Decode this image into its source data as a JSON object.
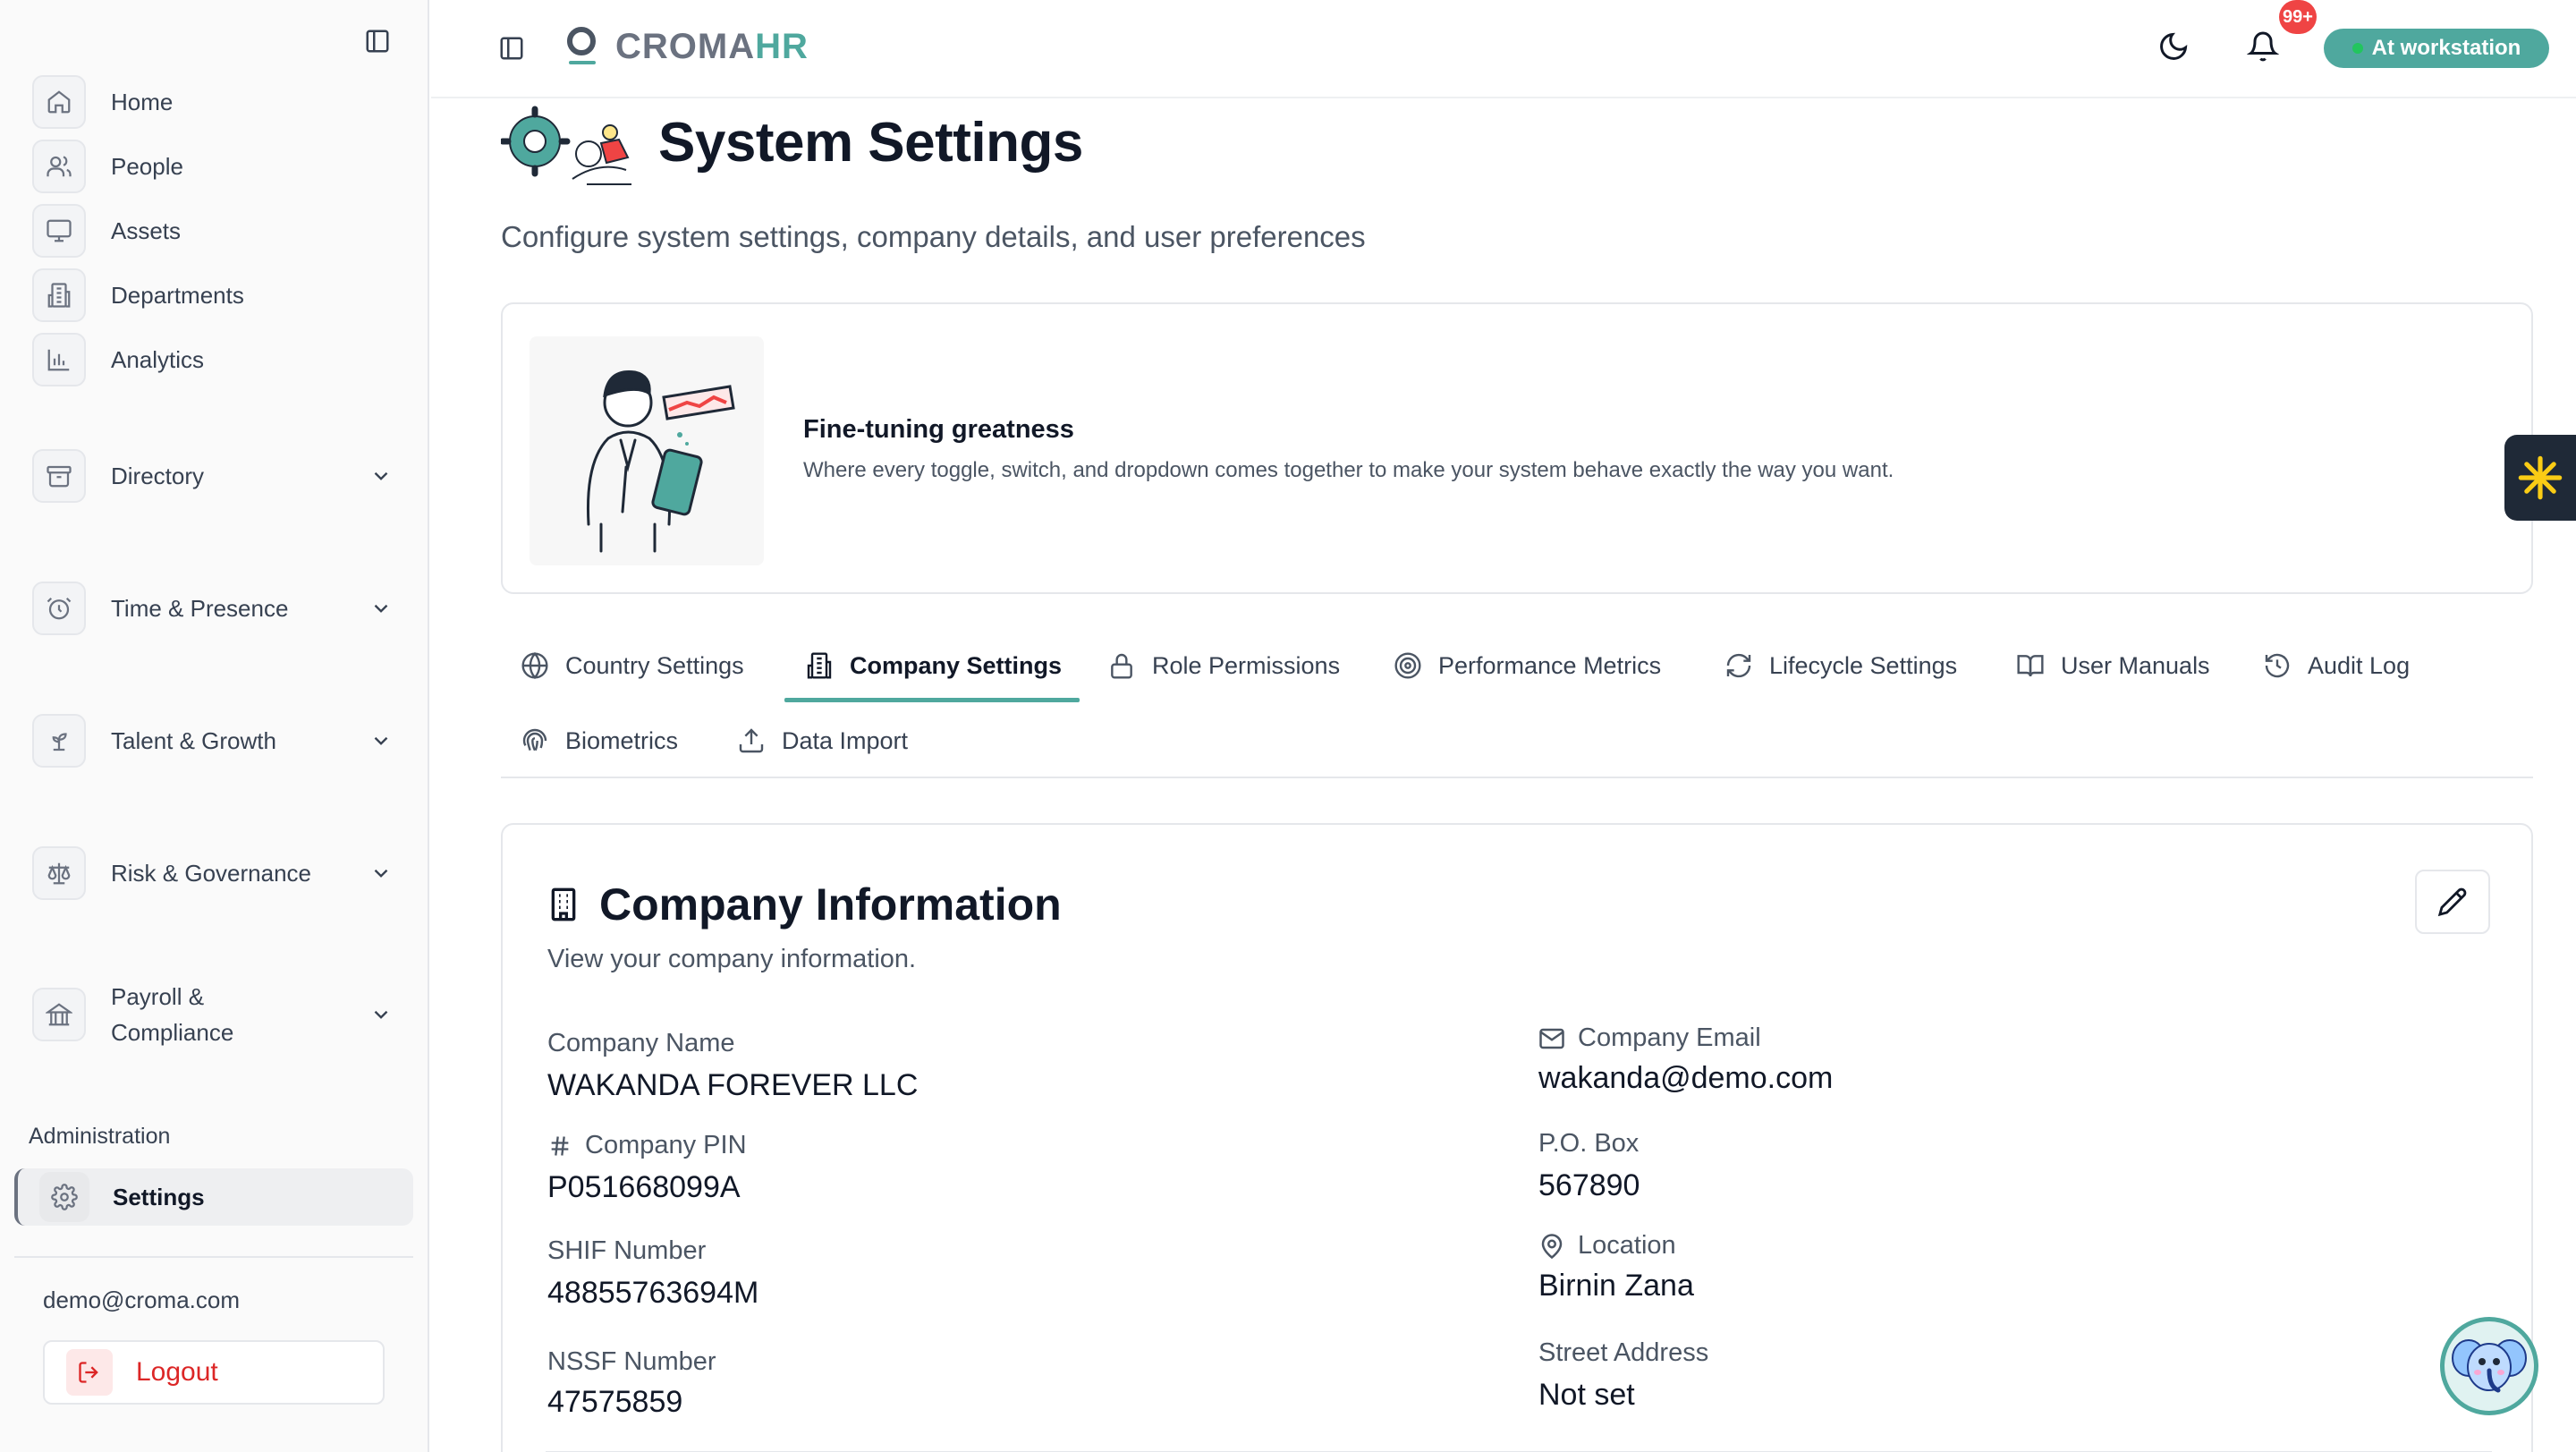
{
  "sidebar": {
    "items": [
      {
        "label": "Home",
        "icon": "home-icon"
      },
      {
        "label": "People",
        "icon": "users-icon"
      },
      {
        "label": "Assets",
        "icon": "monitor-icon"
      },
      {
        "label": "Departments",
        "icon": "building-icon"
      },
      {
        "label": "Analytics",
        "icon": "bar-chart-icon"
      }
    ],
    "groups": [
      {
        "label": "Directory",
        "icon": "archive-icon"
      },
      {
        "label": "Time & Presence",
        "icon": "alarm-clock-icon"
      },
      {
        "label": "Talent & Growth",
        "icon": "sprout-icon"
      },
      {
        "label": "Risk & Governance",
        "icon": "scale-icon"
      },
      {
        "label": "Payroll &",
        "label2": "Compliance",
        "icon": "landmark-icon"
      }
    ],
    "section_label": "Administration",
    "active_item": {
      "label": "Settings",
      "icon": "gear-icon"
    },
    "user_email": "demo@croma.com",
    "logout_label": "Logout"
  },
  "topbar": {
    "logo_part1": "CROMA",
    "logo_part2": "HR",
    "notification_badge": "99+",
    "status_label": "At workstation",
    "accent_color": "#4fa89e"
  },
  "header": {
    "title": "System Settings",
    "subtitle": "Configure system settings, company details, and user preferences"
  },
  "banner": {
    "title": "Fine-tuning greatness",
    "text": "Where every toggle, switch, and dropdown comes together to make your system behave exactly the way you want."
  },
  "tabs": [
    {
      "label": "Country Settings",
      "icon": "globe-icon"
    },
    {
      "label": "Company Settings",
      "icon": "building-icon",
      "active": true
    },
    {
      "label": "Role Permissions",
      "icon": "lock-icon"
    },
    {
      "label": "Performance Metrics",
      "icon": "target-icon"
    },
    {
      "label": "Lifecycle Settings",
      "icon": "refresh-icon"
    },
    {
      "label": "User Manuals",
      "icon": "book-icon"
    },
    {
      "label": "Audit Log",
      "icon": "history-icon"
    },
    {
      "label": "Biometrics",
      "icon": "fingerprint-icon"
    },
    {
      "label": "Data Import",
      "icon": "upload-icon"
    }
  ],
  "company": {
    "title": "Company Information",
    "subtitle": "View your company information.",
    "fields": {
      "name": {
        "label": "Company Name",
        "value": "WAKANDA FOREVER LLC"
      },
      "pin": {
        "label": "Company PIN",
        "value": "P051668099A"
      },
      "shif": {
        "label": "SHIF Number",
        "value": "48855763694M"
      },
      "nssf": {
        "label": "NSSF Number",
        "value": "47575859"
      },
      "email": {
        "label": "Company Email",
        "value": "wakanda@demo.com"
      },
      "pobox": {
        "label": "P.O. Box",
        "value": "567890"
      },
      "location": {
        "label": "Location",
        "value": "Birnin Zana"
      },
      "street": {
        "label": "Street Address",
        "value": "Not set"
      }
    }
  }
}
